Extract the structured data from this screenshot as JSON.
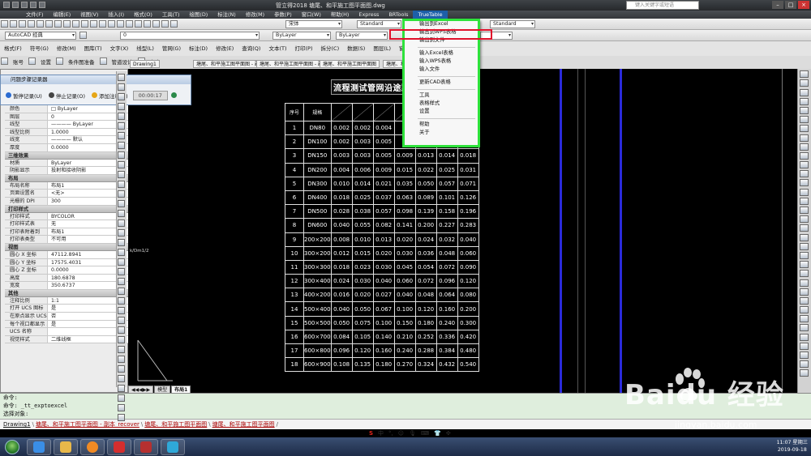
{
  "window": {
    "title": "管立得2018     塘尾、和平施工图平面图.dwg",
    "search_placeholder": "键入关键字或短语"
  },
  "menubar": [
    "文件(F)",
    "编辑(E)",
    "视图(V)",
    "插入(I)",
    "格式(O)",
    "工具(T)",
    "绘图(D)",
    "标注(N)",
    "修改(M)",
    "参数(P)",
    "窗口(W)",
    "帮助(H)",
    "Express",
    "BRTools",
    "TrueTable"
  ],
  "toolbar": {
    "workspace": "AutoCAD 经典",
    "textstyle": "宋体",
    "dimstyle1": "Standard",
    "dimstyle2": "Standard",
    "layer": "0",
    "color": "ByLayer",
    "linetype": "ByLayer",
    "plugin": [
      "格式(F)",
      "符号(G)",
      "修改(M)",
      "图库(T)",
      "文字(X)",
      "线型(L)",
      "管网(G)",
      "标注(D)",
      "修改(E)",
      "查询(Q)",
      "文本(T)",
      "打印(P)",
      "拆分(C)",
      "数据(S)",
      "图层(L)",
      "窗口(W)",
      "帮助(H)",
      "TrueTable"
    ],
    "plugin2": [
      "账号",
      "设置",
      "条件图准备",
      "管道设计",
      "室内"
    ]
  },
  "doc_tabs": [
    "Drawing1",
    "塘尾、和平施工图平面图 - 副本_re",
    "塘尾、和平施工图平面图 - 副本_recover",
    "塘尾、和平施工图平面图",
    "塘尾、和平施工图平面图"
  ],
  "recorder": {
    "title": "问题步骤记录器",
    "pause": "暂停记录(U)",
    "stop": "停止记录(O)",
    "comment": "添加注释(C)",
    "timer": "00:00:17"
  },
  "properties": [
    {
      "section": "",
      "rows": [
        [
          "颜色",
          "□ ByLayer"
        ],
        [
          "图层",
          "0"
        ],
        [
          "线型",
          "———— ByLayer"
        ],
        [
          "线型比例",
          "1.0000"
        ],
        [
          "线宽",
          "———— 默认"
        ],
        [
          "厚度",
          "0.0000"
        ]
      ]
    },
    {
      "section": "三维效果",
      "rows": [
        [
          "材质",
          "ByLayer"
        ],
        [
          "阴影显示",
          "投射和接收阴影"
        ]
      ]
    },
    {
      "section": "布局",
      "rows": [
        [
          "布局名称",
          "布局1"
        ],
        [
          "页面设置名",
          "<无>"
        ],
        [
          "光栅的 DPI",
          "300"
        ]
      ]
    },
    {
      "section": "打印样式",
      "rows": [
        [
          "打印样式",
          "BYCOLOR"
        ],
        [
          "打印样式表",
          "无"
        ],
        [
          "打印表附着到",
          "布局1"
        ],
        [
          "打印表类型",
          "不可用"
        ]
      ]
    },
    {
      "section": "视图",
      "rows": [
        [
          "圆心 X 坐标",
          "47112.8941"
        ],
        [
          "圆心 Y 坐标",
          "17575.4031"
        ],
        [
          "圆心 Z 坐标",
          "0.0000"
        ],
        [
          "高度",
          "180.6878"
        ],
        [
          "宽度",
          "350.6737"
        ]
      ]
    },
    {
      "section": "其他",
      "rows": [
        [
          "注释比例",
          "1:1"
        ],
        [
          "打开 UCS 图标",
          "是"
        ],
        [
          "在原点显示 UCS...",
          "否"
        ],
        [
          "每个视口都显示 ...",
          "是"
        ],
        [
          "UCS 名称",
          ""
        ],
        [
          "视觉样式",
          "二维线框"
        ]
      ]
    }
  ],
  "table": {
    "title": "流程测试管网沿途跌落损失",
    "header": [
      "序号",
      "规格",
      "",
      "",
      "",
      "",
      "",
      "",
      "",
      ""
    ],
    "rows": [
      [
        "1",
        "DN80",
        "0.002",
        "0.002",
        "0.004",
        "",
        "",
        "",
        "0.014"
      ],
      [
        "2",
        "DN100",
        "0.002",
        "0.003",
        "0.005",
        "",
        "",
        "",
        "0.017"
      ],
      [
        "3",
        "DN150",
        "0.003",
        "0.003",
        "0.005",
        "0.009",
        "0.013",
        "0.014",
        "0.018"
      ],
      [
        "4",
        "DN200",
        "0.004",
        "0.006",
        "0.009",
        "0.015",
        "0.022",
        "0.025",
        "0.031"
      ],
      [
        "5",
        "DN300",
        "0.010",
        "0.014",
        "0.021",
        "0.035",
        "0.050",
        "0.057",
        "0.071"
      ],
      [
        "6",
        "DN400",
        "0.018",
        "0.025",
        "0.037",
        "0.063",
        "0.089",
        "0.101",
        "0.126"
      ],
      [
        "7",
        "DN500",
        "0.028",
        "0.038",
        "0.057",
        "0.098",
        "0.139",
        "0.158",
        "0.196"
      ],
      [
        "8",
        "DN600",
        "0.040",
        "0.055",
        "0.082",
        "0.141",
        "0.200",
        "0.227",
        "0.283"
      ],
      [
        "9",
        "200×200",
        "0.008",
        "0.010",
        "0.013",
        "0.020",
        "0.024",
        "0.032",
        "0.040"
      ],
      [
        "10",
        "300×200",
        "0.012",
        "0.015",
        "0.020",
        "0.030",
        "0.036",
        "0.048",
        "0.060"
      ],
      [
        "11",
        "300×300",
        "0.018",
        "0.023",
        "0.030",
        "0.045",
        "0.054",
        "0.072",
        "0.090"
      ],
      [
        "12",
        "300×400",
        "0.024",
        "0.030",
        "0.040",
        "0.060",
        "0.072",
        "0.096",
        "0.120"
      ],
      [
        "13",
        "400×200",
        "0.016",
        "0.020",
        "0.027",
        "0.040",
        "0.048",
        "0.064",
        "0.080"
      ],
      [
        "14",
        "500×400",
        "0.040",
        "0.050",
        "0.067",
        "0.100",
        "0.120",
        "0.160",
        "0.200"
      ],
      [
        "15",
        "500×500",
        "0.050",
        "0.075",
        "0.100",
        "0.150",
        "0.180",
        "0.240",
        "0.300"
      ],
      [
        "16",
        "600×700",
        "0.084",
        "0.105",
        "0.140",
        "0.210",
        "0.252",
        "0.336",
        "0.420"
      ],
      [
        "17",
        "600×800",
        "0.096",
        "0.120",
        "0.160",
        "0.240",
        "0.288",
        "0.384",
        "0.480"
      ],
      [
        "18",
        "600×900",
        "0.108",
        "0.135",
        "0.180",
        "0.270",
        "0.324",
        "0.432",
        "0.540"
      ]
    ]
  },
  "canvas": {
    "scale_label": "k/Dm1/2"
  },
  "model_tabs": [
    "模型",
    "布局1"
  ],
  "truetable_menu": [
    {
      "label": "输出到Excel"
    },
    {
      "label": "输出到WPS表格"
    },
    {
      "label": "输出到文件"
    },
    {
      "sep": true
    },
    {
      "label": "输入Excel表格"
    },
    {
      "label": "输入WPS表格"
    },
    {
      "label": "输入文件"
    },
    {
      "sep": true
    },
    {
      "label": "更新CAD表格"
    },
    {
      "sep": true
    },
    {
      "label": "工具"
    },
    {
      "label": "表格样式"
    },
    {
      "label": "设置"
    },
    {
      "sep": true
    },
    {
      "label": "帮助"
    },
    {
      "label": "关于"
    }
  ],
  "command": {
    "line1": "命令:",
    "line2": "命令: _tt_exptoexcel",
    "line3": "选择对象:"
  },
  "file_tabs": [
    "Drawing1",
    "塘尾、和平施工图平面图 - 副本_recover",
    "塘尾、和平施工图平面图",
    "塘尾、和平施工图平面图"
  ],
  "ime": [
    "S",
    "中",
    "°,",
    "☺",
    "🎙",
    "⌨",
    "👕",
    "✣"
  ],
  "tray": {
    "time": "11:07 星期三",
    "date": "2019-09-18"
  },
  "watermark": {
    "brand": "Baidu 经验",
    "url": "jingyan.baidu.com"
  },
  "colors": {
    "highlight_green": "#2ee23b",
    "highlight_red": "#e0112b",
    "canvas": "#000000",
    "blue_line": "#2a2adb"
  }
}
